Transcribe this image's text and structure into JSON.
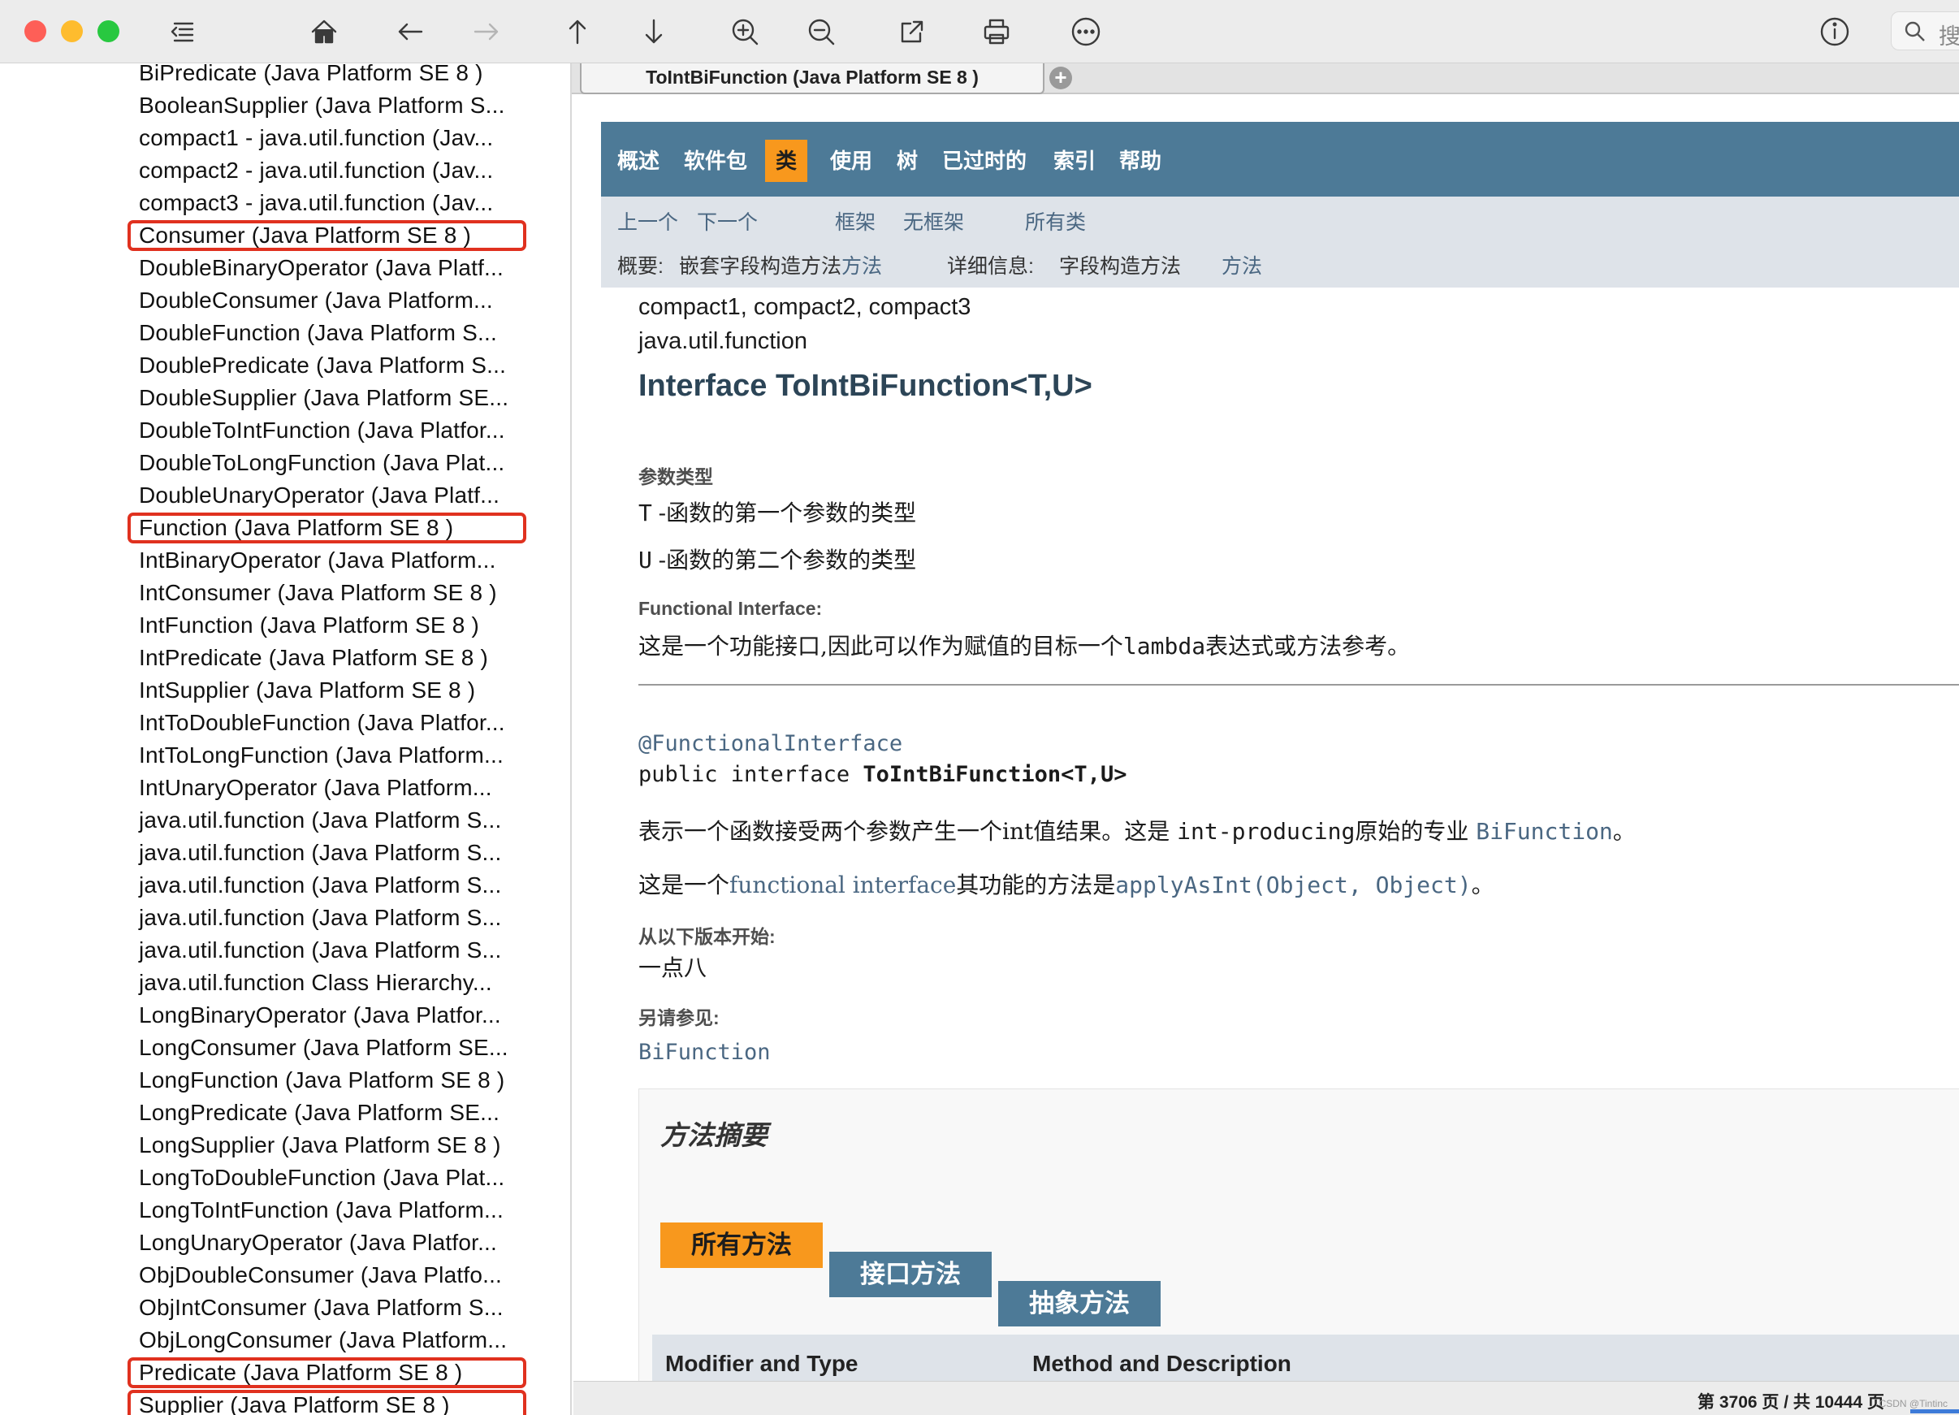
{
  "toolbar": {
    "buttons": [
      "sidebar-toggle",
      "home",
      "back",
      "forward",
      "page-up",
      "page-down",
      "zoom-in",
      "zoom-out",
      "share",
      "print",
      "more"
    ],
    "search_label": "搜"
  },
  "sidebar": {
    "items": [
      {
        "label": "BiPredicate (Java Platform SE 8 )",
        "highlighted": false
      },
      {
        "label": "BooleanSupplier (Java Platform S...",
        "highlighted": false
      },
      {
        "label": "compact1 - java.util.function (Jav...",
        "highlighted": false
      },
      {
        "label": "compact2 - java.util.function (Jav...",
        "highlighted": false
      },
      {
        "label": "compact3 - java.util.function (Jav...",
        "highlighted": false
      },
      {
        "label": "Consumer (Java Platform SE 8 )",
        "highlighted": true
      },
      {
        "label": "DoubleBinaryOperator (Java Platf...",
        "highlighted": false
      },
      {
        "label": "DoubleConsumer (Java Platform...",
        "highlighted": false
      },
      {
        "label": "DoubleFunction (Java Platform S...",
        "highlighted": false
      },
      {
        "label": "DoublePredicate (Java Platform S...",
        "highlighted": false
      },
      {
        "label": "DoubleSupplier (Java Platform SE...",
        "highlighted": false
      },
      {
        "label": "DoubleToIntFunction (Java Platfor...",
        "highlighted": false
      },
      {
        "label": "DoubleToLongFunction (Java Plat...",
        "highlighted": false
      },
      {
        "label": "DoubleUnaryOperator (Java Platf...",
        "highlighted": false
      },
      {
        "label": "Function (Java Platform SE 8 )",
        "highlighted": true
      },
      {
        "label": "IntBinaryOperator (Java Platform...",
        "highlighted": false
      },
      {
        "label": "IntConsumer (Java Platform SE 8 )",
        "highlighted": false
      },
      {
        "label": "IntFunction (Java Platform SE 8 )",
        "highlighted": false
      },
      {
        "label": "IntPredicate (Java Platform SE 8 )",
        "highlighted": false
      },
      {
        "label": "IntSupplier (Java Platform SE 8 )",
        "highlighted": false
      },
      {
        "label": "IntToDoubleFunction (Java Platfor...",
        "highlighted": false
      },
      {
        "label": "IntToLongFunction (Java Platform...",
        "highlighted": false
      },
      {
        "label": "IntUnaryOperator (Java Platform...",
        "highlighted": false
      },
      {
        "label": "java.util.function (Java Platform S...",
        "highlighted": false
      },
      {
        "label": "java.util.function (Java Platform S...",
        "highlighted": false
      },
      {
        "label": "java.util.function (Java Platform S...",
        "highlighted": false
      },
      {
        "label": "java.util.function (Java Platform S...",
        "highlighted": false
      },
      {
        "label": "java.util.function (Java Platform S...",
        "highlighted": false
      },
      {
        "label": "java.util.function Class Hierarchy...",
        "highlighted": false
      },
      {
        "label": "LongBinaryOperator (Java Platfor...",
        "highlighted": false
      },
      {
        "label": "LongConsumer (Java Platform SE...",
        "highlighted": false
      },
      {
        "label": "LongFunction (Java Platform SE 8 )",
        "highlighted": false
      },
      {
        "label": "LongPredicate (Java Platform SE...",
        "highlighted": false
      },
      {
        "label": "LongSupplier (Java Platform SE 8 )",
        "highlighted": false
      },
      {
        "label": "LongToDoubleFunction (Java Plat...",
        "highlighted": false
      },
      {
        "label": "LongToIntFunction (Java Platform...",
        "highlighted": false
      },
      {
        "label": "LongUnaryOperator (Java Platfor...",
        "highlighted": false
      },
      {
        "label": "ObjDoubleConsumer (Java Platfo...",
        "highlighted": false
      },
      {
        "label": "ObjIntConsumer (Java Platform S...",
        "highlighted": false
      },
      {
        "label": "ObjLongConsumer (Java Platform...",
        "highlighted": false
      },
      {
        "label": "Predicate (Java Platform SE 8 )",
        "highlighted": true
      },
      {
        "label": "Supplier (Java Platform SE 8 )",
        "highlighted": true
      }
    ]
  },
  "tab": {
    "title": "ToIntBiFunction (Java Platform SE 8 )",
    "add_label": "+"
  },
  "navbar": {
    "overview": "概述",
    "package": "软件包",
    "class": "类",
    "use": "使用",
    "tree": "树",
    "deprecated": "已过时的",
    "index": "索引",
    "help": "帮助"
  },
  "subnav": {
    "prev": "上一个",
    "next": "下一个",
    "frames": "框架",
    "no_frames": "无框架",
    "all_classes": "所有类",
    "summary_label": "概要:",
    "summary_text": "嵌套字段构造方法",
    "summary_link": "方法",
    "detail_label": "详细信息:",
    "detail_text": "字段构造方法",
    "detail_link": "方法"
  },
  "header": {
    "profiles": "compact1, compact2, compact3",
    "package": "java.util.function",
    "title": "Interface ToIntBiFunction<T,U>"
  },
  "type_params": {
    "label": "参数类型",
    "t_name": "T",
    "t_desc": "-函数的第一个参数的类型",
    "u_name": "U",
    "u_desc": "-函数的第二个参数的类型"
  },
  "functional_interface": {
    "label": "Functional Interface:",
    "desc_before": "这是一个功能接口,因此可以作为赋值的目标一个",
    "desc_code": "lambda",
    "desc_after": "表达式或方法参考。"
  },
  "declaration": {
    "annotation": "@FunctionalInterface",
    "prefix": "public interface ",
    "name": "ToIntBiFunction<T,U>"
  },
  "description": {
    "p1_before": "表示一个函数接受两个参数产生一个int值结果。这是 ",
    "p1_code": "int-producing",
    "p1_mid": "原始的专业 ",
    "p1_link": "BiFunction",
    "p1_end": "。",
    "p2_before": "这是一个",
    "p2_link": "functional interface",
    "p2_mid": "其功能的方法是",
    "p2_method": "applyAsInt(Object, Object)",
    "p2_end": "。"
  },
  "since": {
    "label": "从以下版本开始:",
    "value": "一点八"
  },
  "see_also": {
    "label": "另请参见:",
    "link": "BiFunction"
  },
  "method_summary": {
    "title": "方法摘要",
    "tabs": [
      "所有方法",
      "接口方法",
      "抽象方法"
    ],
    "col_modifier": "Modifier and Type",
    "col_method": "Method and Description"
  },
  "status": {
    "page": "第 3706 页 / 共 10444 页",
    "watermark": "CSDN @Tintinc"
  },
  "colors": {
    "nav_bg": "#4d7a97",
    "active_tab": "#f8981d",
    "subnav_bg": "#dee3e9",
    "link": "#4a6782",
    "highlight_box": "#e0311f"
  }
}
